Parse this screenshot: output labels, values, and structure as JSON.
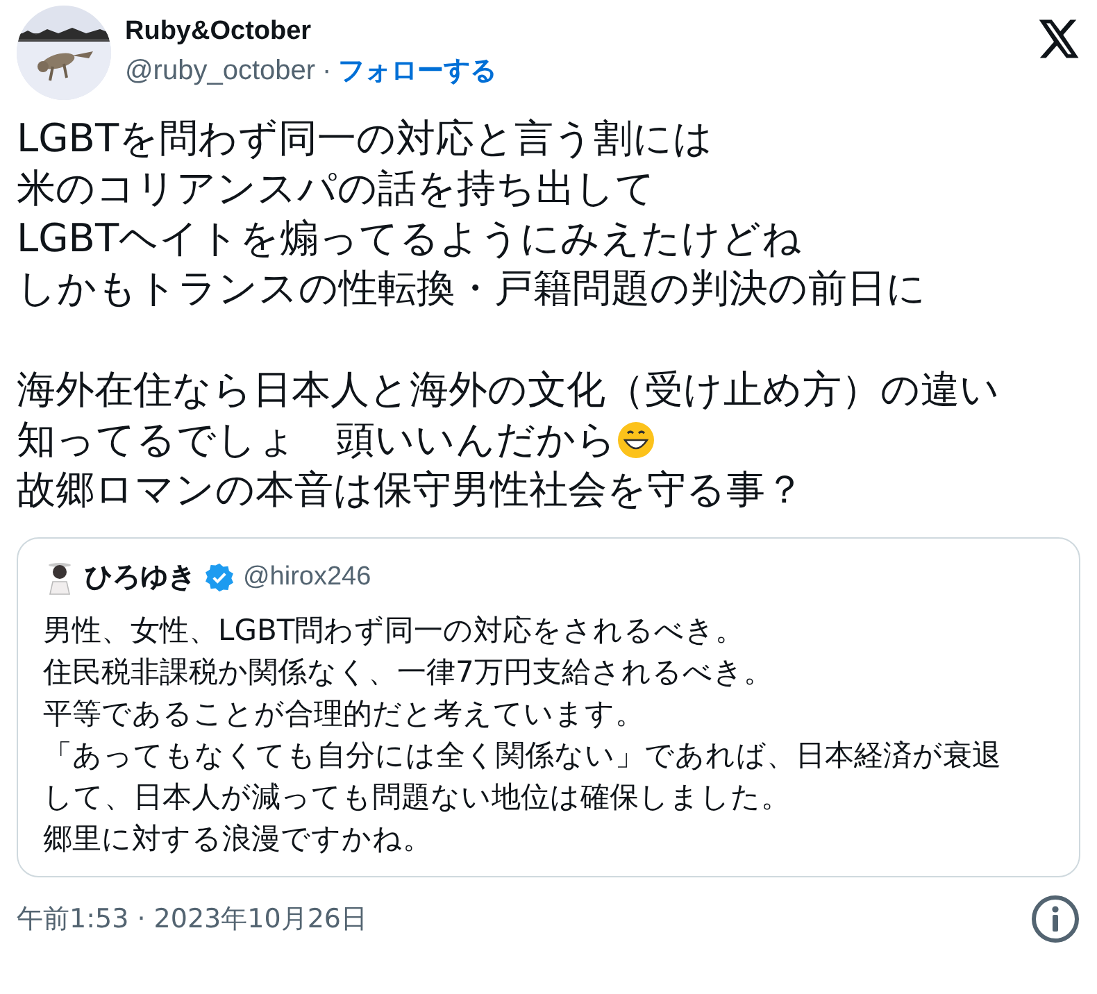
{
  "author": {
    "name": "Ruby&October",
    "handle": "@ruby_october",
    "separator": "·",
    "follow": "フォローする"
  },
  "paragraphs": [
    [
      {
        "text": "LGBTを問わず同一の対応と言う割には",
        "trailing_icon": false
      },
      {
        "text": "米のコリアンスパの話を持ち出して",
        "trailing_icon": false
      },
      {
        "text": "LGBTヘイトを煽ってるようにみえたけどね",
        "trailing_icon": false
      },
      {
        "text": "しかもトランスの性転換・戸籍問題の判決の前日に",
        "trailing_icon": false
      }
    ],
    [
      {
        "text": "海外在住なら日本人と海外の文化（受け止め方）の違い",
        "trailing_icon": false
      },
      {
        "text": "知ってるでしょ　頭いいんだから",
        "trailing_icon": true
      },
      {
        "text": "故郷ロマンの本音は保守男性社会を守る事？",
        "trailing_icon": false
      }
    ]
  ],
  "quote": {
    "name": "ひろゆき",
    "verified": true,
    "handle": "@hirox246",
    "lines": [
      "男性、女性、LGBT問わず同一の対応をされるべき。",
      "住民税非課税か関係なく、一律7万円支給されるべき。",
      "平等であることが合理的だと考えています。",
      "「あってもなくても自分には全く関係ない」であれば、日本経済が衰退",
      "して、日本人が減っても問題ない地位は確保しました。",
      "郷里に対する浪漫ですかね。"
    ]
  },
  "timestamp": "午前1:53 · 2023年10月26日"
}
